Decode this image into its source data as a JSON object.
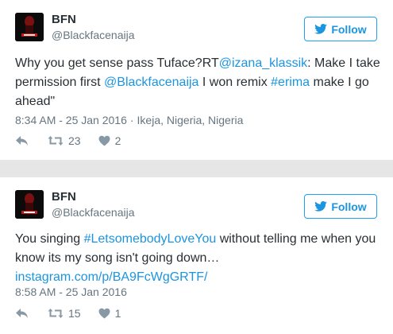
{
  "tweets": [
    {
      "name": "BFN",
      "handle": "@Blackfacenaija",
      "follow_label": "Follow",
      "text": [
        {
          "t": "Why you get sense pass Tuface?RT",
          "link": false
        },
        {
          "t": "@izana_klassik",
          "link": true
        },
        {
          "t": ": Make I take permission first ",
          "link": false
        },
        {
          "t": "@Blackfacenaija",
          "link": true
        },
        {
          "t": " I won remix ",
          "link": false
        },
        {
          "t": "#erima",
          "link": true
        },
        {
          "t": " make I go ahead\"",
          "link": false
        }
      ],
      "timestamp": "8:34 AM - 25 Jan 2016",
      "location": "Ikeja, Nigeria, Nigeria",
      "retweets": "23",
      "likes": "2"
    },
    {
      "name": "BFN",
      "handle": "@Blackfacenaija",
      "follow_label": "Follow",
      "text": [
        {
          "t": "You singing ",
          "link": false
        },
        {
          "t": "#LetsomebodyLoveYou",
          "link": true
        },
        {
          "t": " without telling me when you know its my song isn't going down… ",
          "link": false
        },
        {
          "t": "instagram.com/p/BA9FcWgGRTF/",
          "link": true
        }
      ],
      "timestamp": "8:58 AM - 25 Jan 2016",
      "location": "",
      "retweets": "15",
      "likes": "1"
    }
  ],
  "colors": {
    "link": "#1b95e0",
    "secondary_text": "#66757f",
    "primary_text": "#292f33",
    "separator_bg": "#e6e6e6"
  },
  "icons": {
    "follow": "twitter-bird-icon",
    "reply": "reply-icon",
    "retweet": "retweet-icon",
    "like": "heart-icon"
  }
}
